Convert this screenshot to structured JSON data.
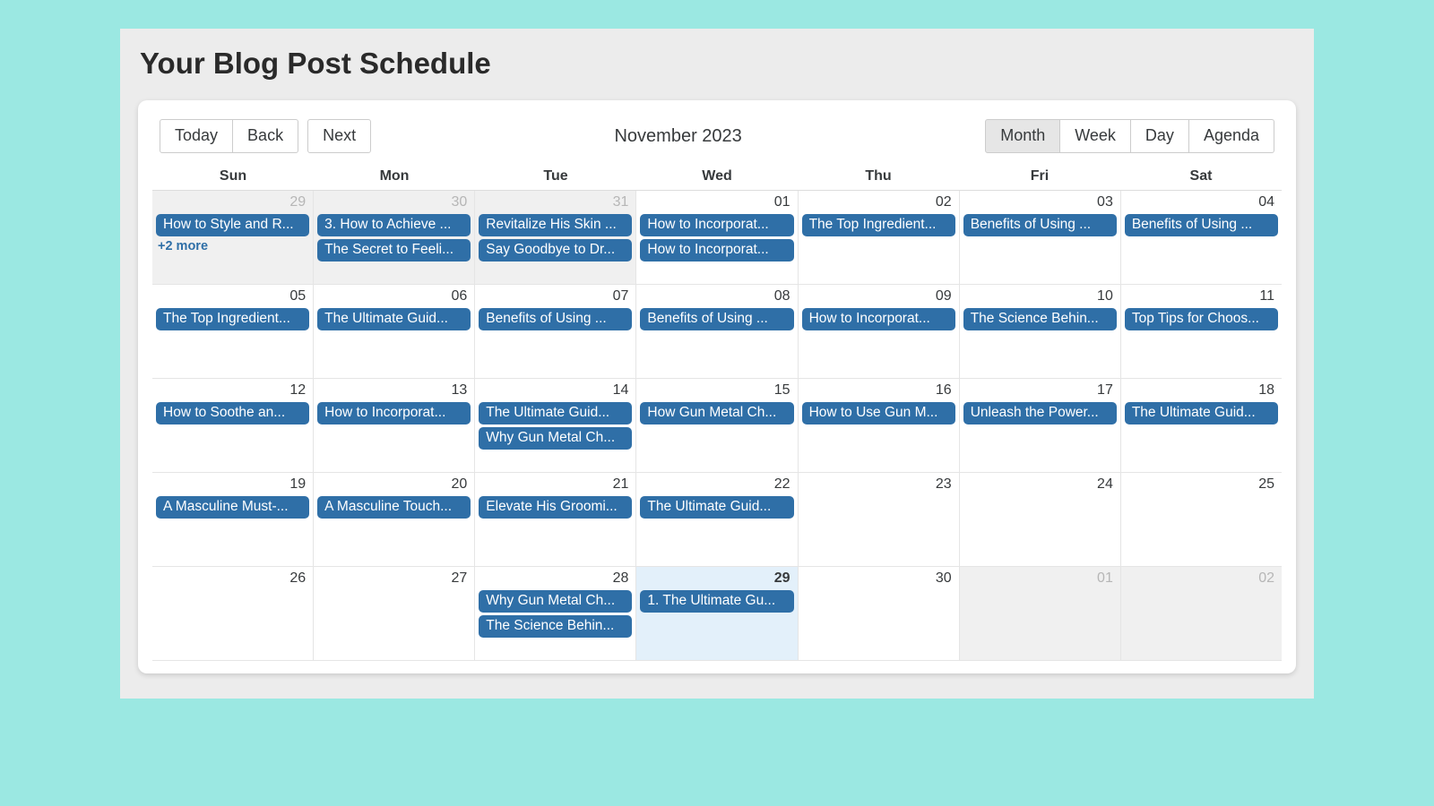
{
  "page_title": "Your Blog Post Schedule",
  "toolbar": {
    "nav": {
      "today": "Today",
      "back": "Back",
      "next": "Next"
    },
    "label": "November 2023",
    "views": {
      "month": "Month",
      "week": "Week",
      "day": "Day",
      "agenda": "Agenda"
    },
    "active_view": "month"
  },
  "day_headers": [
    "Sun",
    "Mon",
    "Tue",
    "Wed",
    "Thu",
    "Fri",
    "Sat"
  ],
  "weeks": [
    {
      "days": [
        {
          "date": "29",
          "off": true,
          "today": false,
          "more": "+2 more",
          "events": [
            "How to Style and R..."
          ]
        },
        {
          "date": "30",
          "off": true,
          "today": false,
          "events": [
            "3. How to Achieve ...",
            "The Secret to Feeli..."
          ]
        },
        {
          "date": "31",
          "off": true,
          "today": false,
          "events": [
            "Revitalize His Skin ...",
            "Say Goodbye to Dr..."
          ]
        },
        {
          "date": "01",
          "off": false,
          "today": false,
          "events": [
            "How to Incorporat...",
            "How to Incorporat..."
          ]
        },
        {
          "date": "02",
          "off": false,
          "today": false,
          "events": [
            "The Top Ingredient..."
          ]
        },
        {
          "date": "03",
          "off": false,
          "today": false,
          "events": [
            "Benefits of Using ..."
          ]
        },
        {
          "date": "04",
          "off": false,
          "today": false,
          "events": [
            "Benefits of Using ..."
          ]
        }
      ]
    },
    {
      "days": [
        {
          "date": "05",
          "off": false,
          "today": false,
          "events": [
            "The Top Ingredient..."
          ]
        },
        {
          "date": "06",
          "off": false,
          "today": false,
          "events": [
            "The Ultimate Guid..."
          ]
        },
        {
          "date": "07",
          "off": false,
          "today": false,
          "events": [
            "Benefits of Using ..."
          ]
        },
        {
          "date": "08",
          "off": false,
          "today": false,
          "events": [
            "Benefits of Using ..."
          ]
        },
        {
          "date": "09",
          "off": false,
          "today": false,
          "events": [
            "How to Incorporat..."
          ]
        },
        {
          "date": "10",
          "off": false,
          "today": false,
          "events": [
            "The Science Behin..."
          ]
        },
        {
          "date": "11",
          "off": false,
          "today": false,
          "events": [
            "Top Tips for Choos..."
          ]
        }
      ]
    },
    {
      "days": [
        {
          "date": "12",
          "off": false,
          "today": false,
          "events": [
            "How to Soothe an..."
          ]
        },
        {
          "date": "13",
          "off": false,
          "today": false,
          "events": [
            "How to Incorporat..."
          ]
        },
        {
          "date": "14",
          "off": false,
          "today": false,
          "events": [
            "The Ultimate Guid...",
            "Why Gun Metal Ch..."
          ]
        },
        {
          "date": "15",
          "off": false,
          "today": false,
          "events": [
            "How Gun Metal Ch..."
          ]
        },
        {
          "date": "16",
          "off": false,
          "today": false,
          "events": [
            "How to Use Gun M..."
          ]
        },
        {
          "date": "17",
          "off": false,
          "today": false,
          "events": [
            "Unleash the Power..."
          ]
        },
        {
          "date": "18",
          "off": false,
          "today": false,
          "events": [
            "The Ultimate Guid..."
          ]
        }
      ]
    },
    {
      "days": [
        {
          "date": "19",
          "off": false,
          "today": false,
          "events": [
            "A Masculine Must-..."
          ]
        },
        {
          "date": "20",
          "off": false,
          "today": false,
          "events": [
            "A Masculine Touch..."
          ]
        },
        {
          "date": "21",
          "off": false,
          "today": false,
          "events": [
            "Elevate His Groomi..."
          ]
        },
        {
          "date": "22",
          "off": false,
          "today": false,
          "events": [
            "The Ultimate Guid..."
          ]
        },
        {
          "date": "23",
          "off": false,
          "today": false,
          "events": []
        },
        {
          "date": "24",
          "off": false,
          "today": false,
          "events": []
        },
        {
          "date": "25",
          "off": false,
          "today": false,
          "events": []
        }
      ]
    },
    {
      "days": [
        {
          "date": "26",
          "off": false,
          "today": false,
          "events": []
        },
        {
          "date": "27",
          "off": false,
          "today": false,
          "events": []
        },
        {
          "date": "28",
          "off": false,
          "today": false,
          "events": [
            "Why Gun Metal Ch...",
            "The Science Behin..."
          ]
        },
        {
          "date": "29",
          "off": false,
          "today": true,
          "events": [
            "1. The Ultimate Gu..."
          ]
        },
        {
          "date": "30",
          "off": false,
          "today": false,
          "events": []
        },
        {
          "date": "01",
          "off": true,
          "today": false,
          "events": []
        },
        {
          "date": "02",
          "off": true,
          "today": false,
          "events": []
        }
      ]
    }
  ]
}
